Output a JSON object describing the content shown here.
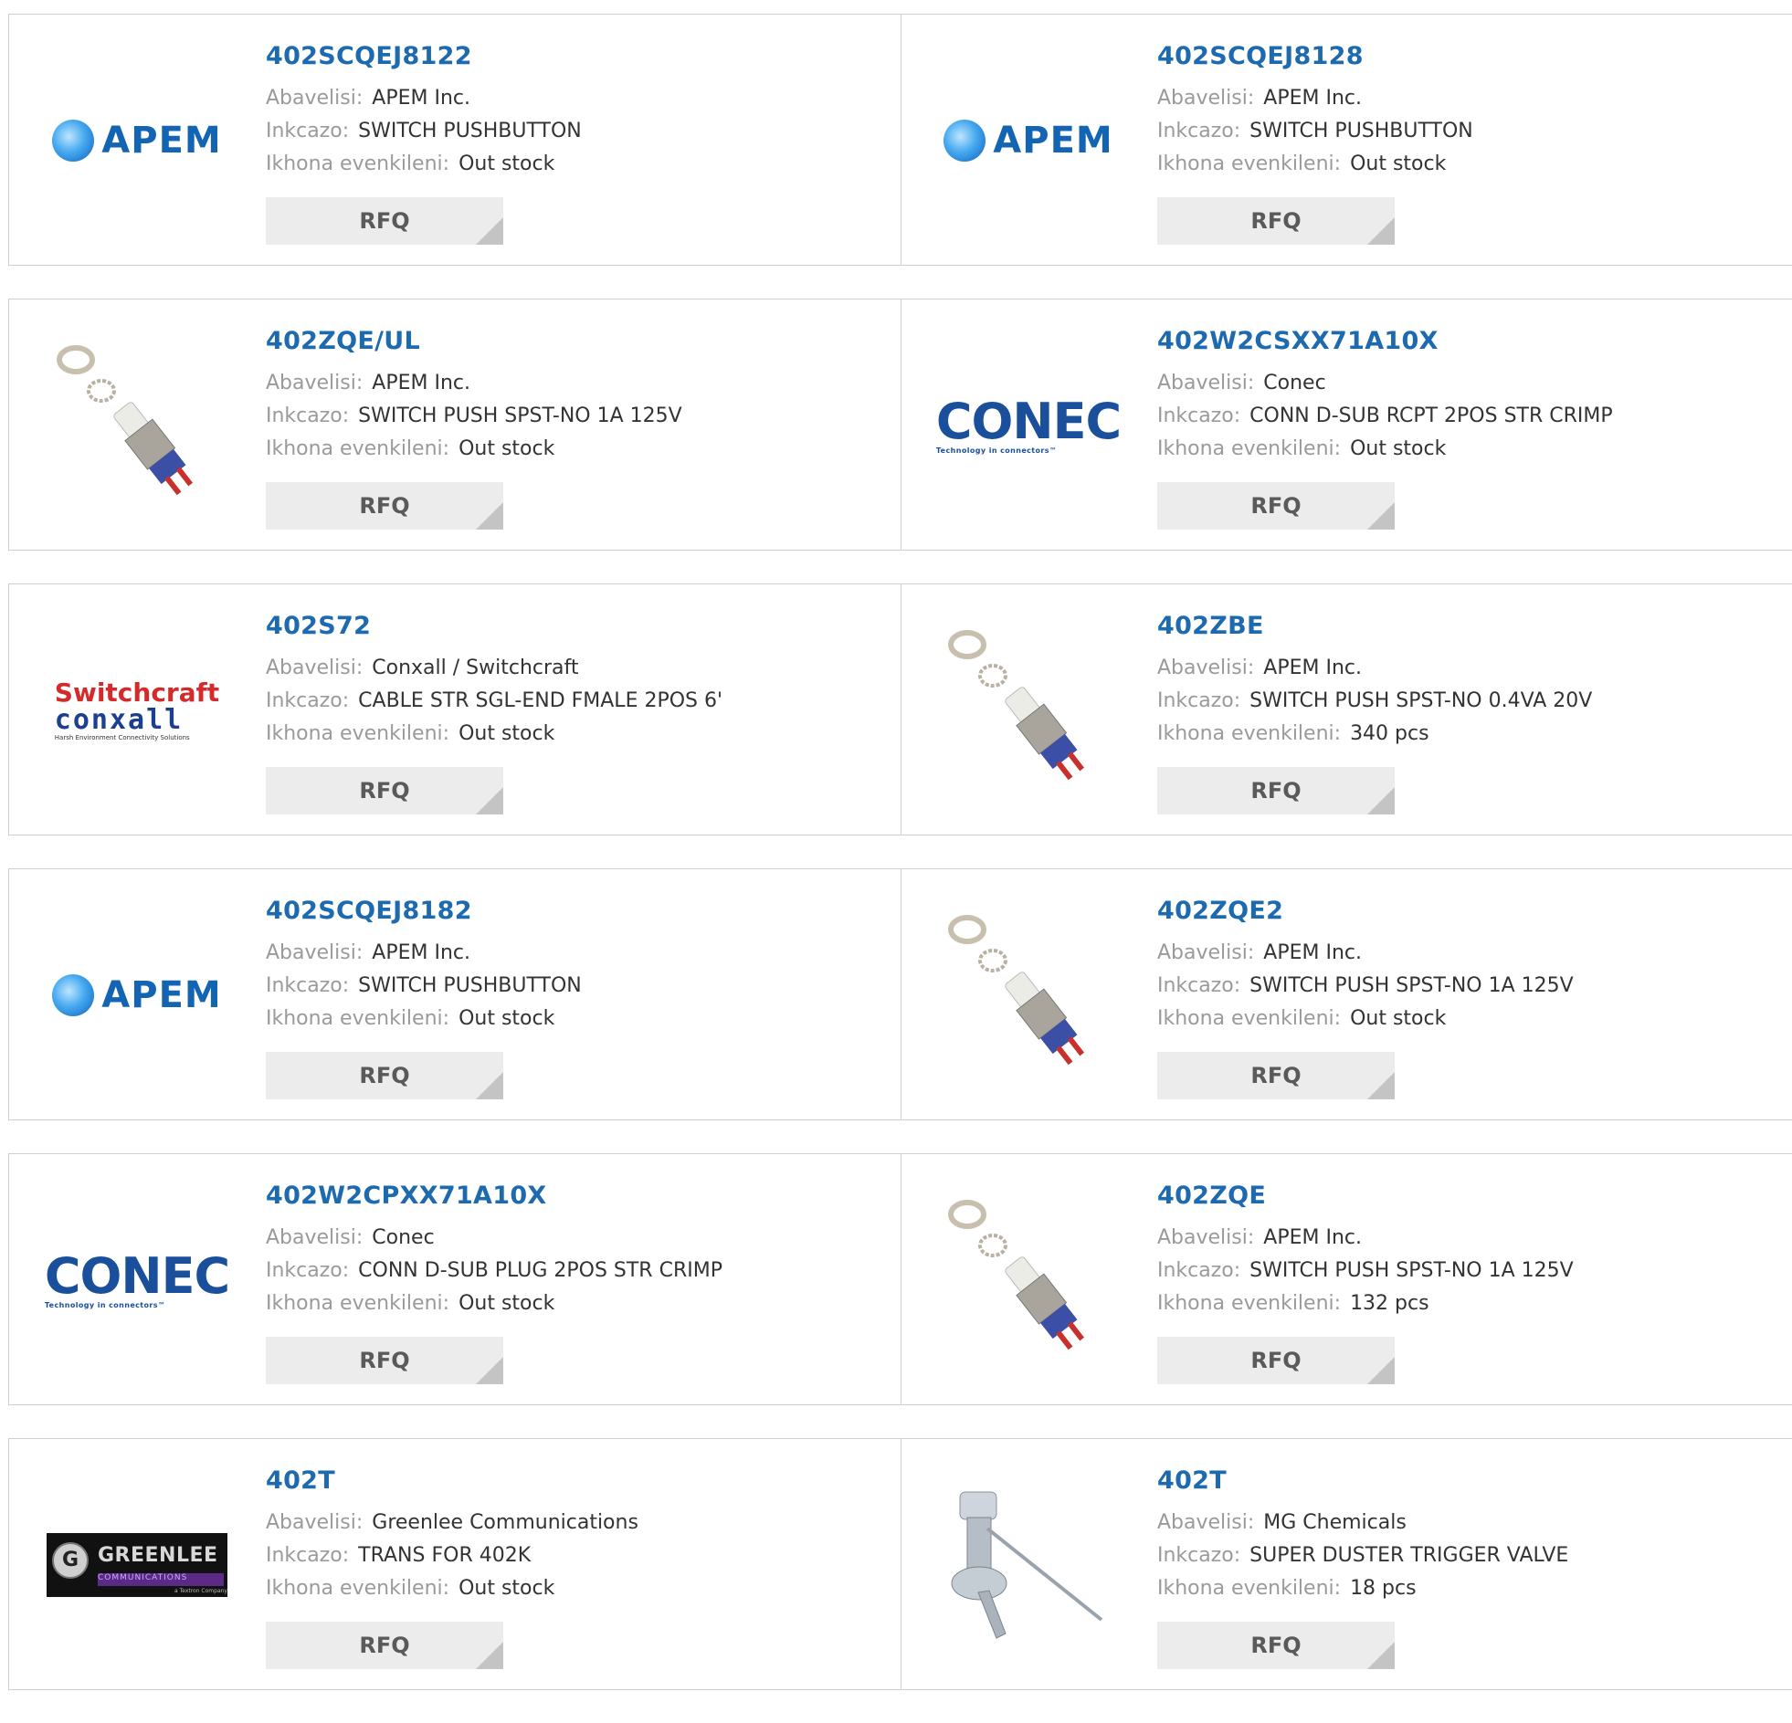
{
  "labels": {
    "manufacturer": "Abavelisi:",
    "description": "Inkcazo:",
    "stock": "Ikhona evenkileni:",
    "rfq": "RFQ"
  },
  "logos": {
    "apem": "APEM",
    "conec": "CONEC",
    "conec_tagline": "Technology in connectors™",
    "switchcraft_top": "Switchcraft",
    "switchcraft_mid": "conxall",
    "switchcraft_sub": "Harsh Environment Connectivity Solutions",
    "greenlee": "GREENLEE",
    "greenlee_letter": "G",
    "greenlee_sub": "COMMUNICATIONS",
    "greenlee_sub2": "a Textron Company"
  },
  "products": [
    {
      "pn": "402SCQEJ8122",
      "manufacturer": "APEM Inc.",
      "description": "SWITCH PUSHBUTTON",
      "stock": "Out stock",
      "image": "apem-logo"
    },
    {
      "pn": "402SCQEJ8128",
      "manufacturer": "APEM Inc.",
      "description": "SWITCH PUSHBUTTON",
      "stock": "Out stock",
      "image": "apem-logo"
    },
    {
      "pn": "402ZQE/UL",
      "manufacturer": "APEM Inc.",
      "description": "SWITCH PUSH SPST-NO 1A 125V",
      "stock": "Out stock",
      "image": "pushbutton-switch-photo"
    },
    {
      "pn": "402W2CSXX71A10X",
      "manufacturer": "Conec",
      "description": "CONN D-SUB RCPT 2POS STR CRIMP",
      "stock": "Out stock",
      "image": "conec-logo"
    },
    {
      "pn": "402S72",
      "manufacturer": "Conxall / Switchcraft",
      "description": "CABLE STR SGL-END FMALE 2POS 6'",
      "stock": "Out stock",
      "image": "switchcraft-logo"
    },
    {
      "pn": "402ZBE",
      "manufacturer": "APEM Inc.",
      "description": "SWITCH PUSH SPST-NO 0.4VA 20V",
      "stock": "340 pcs",
      "image": "pushbutton-switch-photo"
    },
    {
      "pn": "402SCQEJ8182",
      "manufacturer": "APEM Inc.",
      "description": "SWITCH PUSHBUTTON",
      "stock": "Out stock",
      "image": "apem-logo"
    },
    {
      "pn": "402ZQE2",
      "manufacturer": "APEM Inc.",
      "description": "SWITCH PUSH SPST-NO 1A 125V",
      "stock": "Out stock",
      "image": "pushbutton-switch-photo"
    },
    {
      "pn": "402W2CPXX71A10X",
      "manufacturer": "Conec",
      "description": "CONN D-SUB PLUG 2POS STR CRIMP",
      "stock": "Out stock",
      "image": "conec-logo"
    },
    {
      "pn": "402ZQE",
      "manufacturer": "APEM Inc.",
      "description": "SWITCH PUSH SPST-NO 1A 125V",
      "stock": "132 pcs",
      "image": "pushbutton-switch-photo"
    },
    {
      "pn": "402T",
      "manufacturer": "Greenlee Communications",
      "description": "TRANS FOR 402K",
      "stock": "Out stock",
      "image": "greenlee-logo"
    },
    {
      "pn": "402T",
      "manufacturer": "MG Chemicals",
      "description": "SUPER DUSTER TRIGGER VALVE",
      "stock": "18 pcs",
      "image": "trigger-valve-photo"
    }
  ]
}
